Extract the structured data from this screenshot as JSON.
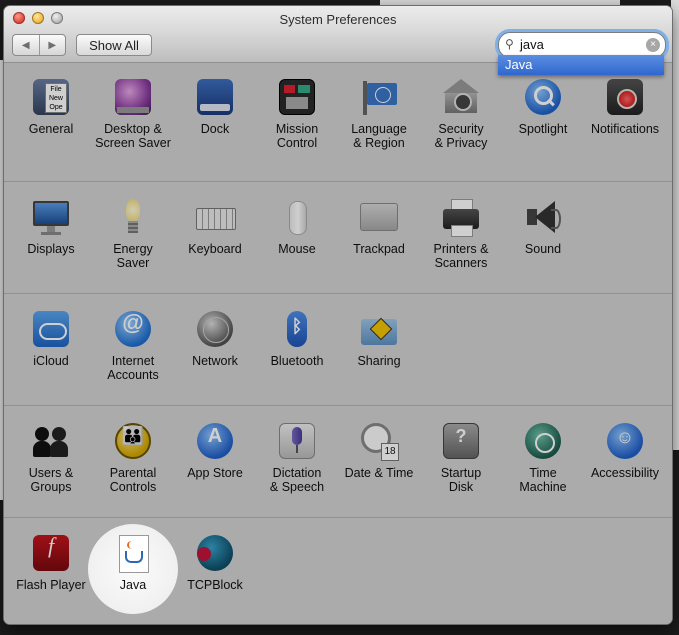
{
  "window": {
    "title": "System Preferences"
  },
  "toolbar": {
    "back_glyph": "◀",
    "forward_glyph": "▶",
    "show_all_label": "Show All",
    "search": {
      "value": "java",
      "suggestion": "Java",
      "search_glyph": "⚲",
      "clear_glyph": "×"
    }
  },
  "colors": {
    "highlight": "#2f67d0",
    "focus_ring": "#7fb0e6",
    "row_bg": "#d3d3d3"
  },
  "sections": [
    {
      "items": [
        {
          "name": "general",
          "label": "General",
          "icon": "general-icon"
        },
        {
          "name": "desktop-screen-saver",
          "label": "Desktop &\nScreen Saver",
          "icon": "desktop-icon"
        },
        {
          "name": "dock",
          "label": "Dock",
          "icon": "dock-icon"
        },
        {
          "name": "mission-control",
          "label": "Mission\nControl",
          "icon": "mission-control-icon"
        },
        {
          "name": "language-region",
          "label": "Language\n& Region",
          "icon": "un-flag-icon"
        },
        {
          "name": "security-privacy",
          "label": "Security\n& Privacy",
          "icon": "house-lock-icon"
        },
        {
          "name": "spotlight",
          "label": "Spotlight",
          "icon": "magnifier-icon"
        },
        {
          "name": "notifications",
          "label": "Notifications",
          "icon": "notifications-icon"
        }
      ]
    },
    {
      "items": [
        {
          "name": "displays",
          "label": "Displays",
          "icon": "monitor-icon"
        },
        {
          "name": "energy-saver",
          "label": "Energy\nSaver",
          "icon": "bulb-icon"
        },
        {
          "name": "keyboard",
          "label": "Keyboard",
          "icon": "keyboard-icon"
        },
        {
          "name": "mouse",
          "label": "Mouse",
          "icon": "mouse-icon"
        },
        {
          "name": "trackpad",
          "label": "Trackpad",
          "icon": "trackpad-icon"
        },
        {
          "name": "printers-scanners",
          "label": "Printers &\nScanners",
          "icon": "printer-icon"
        },
        {
          "name": "sound",
          "label": "Sound",
          "icon": "speaker-icon"
        }
      ]
    },
    {
      "items": [
        {
          "name": "icloud",
          "label": "iCloud",
          "icon": "cloud-icon"
        },
        {
          "name": "internet-accounts",
          "label": "Internet\nAccounts",
          "icon": "at-sign-icon"
        },
        {
          "name": "network",
          "label": "Network",
          "icon": "globe-icon"
        },
        {
          "name": "bluetooth",
          "label": "Bluetooth",
          "icon": "bluetooth-icon"
        },
        {
          "name": "sharing",
          "label": "Sharing",
          "icon": "folder-sign-icon"
        }
      ]
    },
    {
      "items": [
        {
          "name": "users-groups",
          "label": "Users &\nGroups",
          "icon": "users-icon"
        },
        {
          "name": "parental-controls",
          "label": "Parental\nControls",
          "icon": "parental-icon"
        },
        {
          "name": "app-store",
          "label": "App Store",
          "icon": "app-store-icon"
        },
        {
          "name": "dictation-speech",
          "label": "Dictation\n& Speech",
          "icon": "microphone-icon"
        },
        {
          "name": "date-time",
          "label": "Date & Time",
          "icon": "clock-calendar-icon"
        },
        {
          "name": "startup-disk",
          "label": "Startup\nDisk",
          "icon": "disk-icon"
        },
        {
          "name": "time-machine",
          "label": "Time\nMachine",
          "icon": "time-machine-icon"
        },
        {
          "name": "accessibility",
          "label": "Accessibility",
          "icon": "accessibility-icon"
        }
      ]
    },
    {
      "items": [
        {
          "name": "flash-player",
          "label": "Flash Player",
          "icon": "flash-icon"
        },
        {
          "name": "java",
          "label": "Java",
          "icon": "java-cup-icon",
          "highlighted": true
        },
        {
          "name": "tcpblock",
          "label": "TCPBlock",
          "icon": "tcpblock-globe-icon"
        }
      ]
    }
  ]
}
